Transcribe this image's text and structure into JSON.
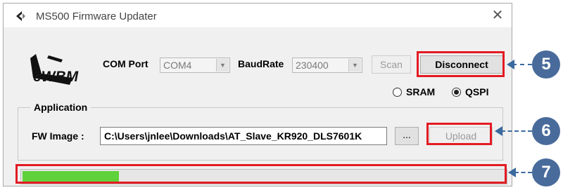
{
  "window": {
    "title": "MS500 Firmware Updater",
    "close_glyph": "✕"
  },
  "logo": {
    "text": "eWBM"
  },
  "connection": {
    "com_port_label": "COM Port",
    "com_port_value": "COM4",
    "baudrate_label": "BaudRate",
    "baudrate_value": "230400",
    "scan_label": "Scan",
    "disconnect_label": "Disconnect"
  },
  "memory": {
    "options": [
      {
        "label": "SRAM",
        "selected": false
      },
      {
        "label": "QSPI",
        "selected": true
      }
    ]
  },
  "application": {
    "group_label": "Application",
    "fw_image_label": "FW Image :",
    "fw_image_path": "C:\\Users\\jnlee\\Downloads\\AT_Slave_KR920_DLS7601K",
    "browse_label": "...",
    "upload_label": "Upload"
  },
  "progress": {
    "fraction": 0.2
  },
  "callouts": {
    "disconnect": "5",
    "upload": "6",
    "progress": "7"
  },
  "colors": {
    "highlight": "#e31b23",
    "callout": "#486b9b",
    "progress_fill": "#5fd13a"
  }
}
